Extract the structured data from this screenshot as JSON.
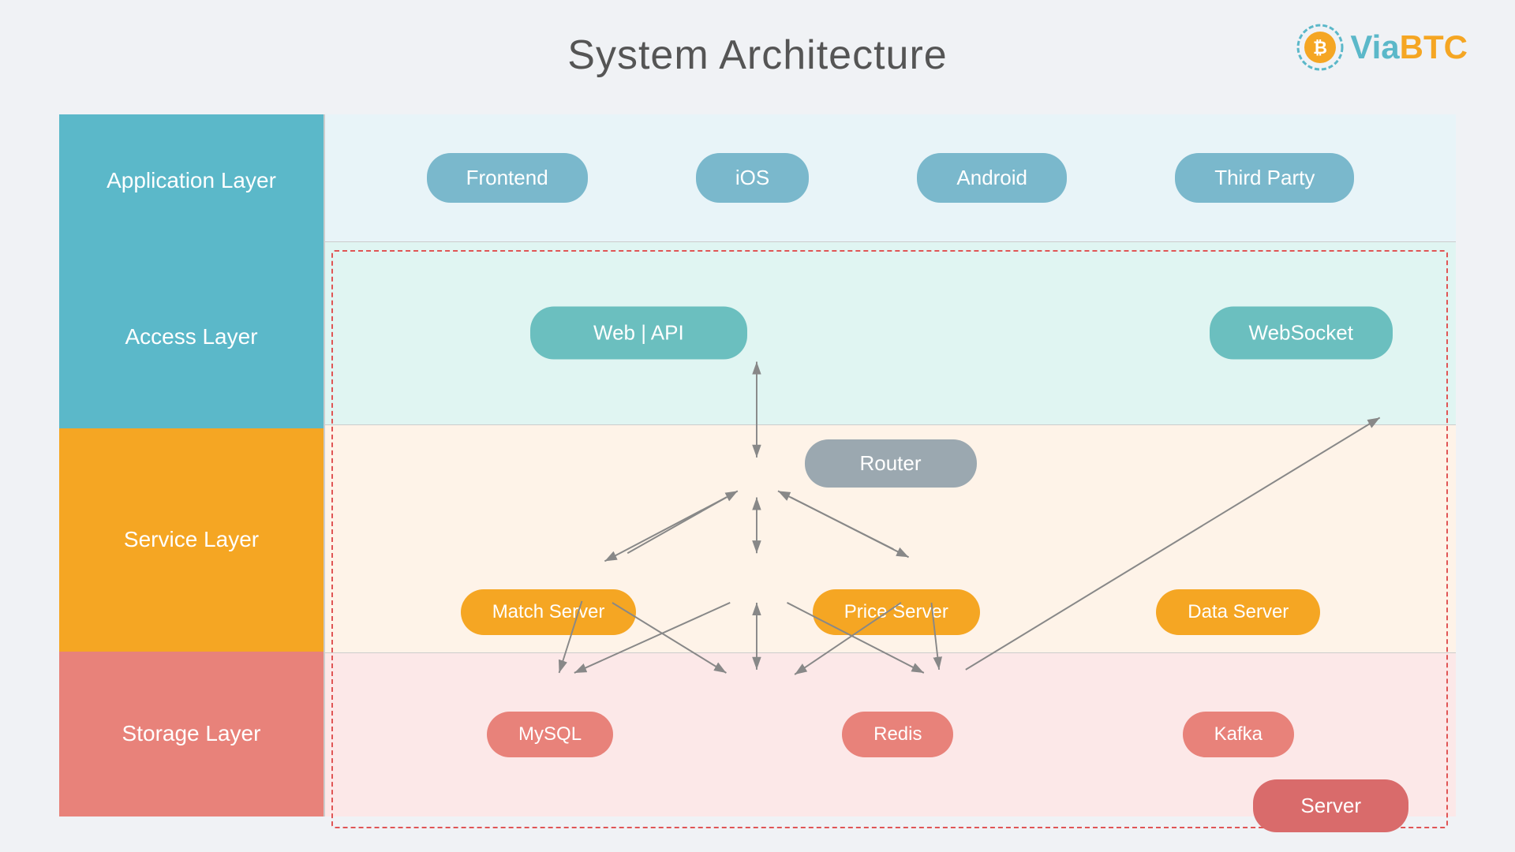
{
  "page": {
    "title": "System Architecture",
    "logo": {
      "via": "Via",
      "btc": "BTC"
    }
  },
  "layers": {
    "application": "Application Layer",
    "access": "Access Layer",
    "service": "Service Layer",
    "storage": "Storage Layer"
  },
  "app_pills": [
    "Frontend",
    "iOS",
    "Android",
    "Third Party"
  ],
  "access_pills": {
    "web_api": "Web  |  API",
    "websocket": "WebSocket"
  },
  "service_pills": {
    "router": "Router",
    "match": "Match Server",
    "price": "Price Server",
    "data": "Data Server"
  },
  "storage_pills": {
    "mysql": "MySQL",
    "redis": "Redis",
    "kafka": "Kafka"
  },
  "server": "Server"
}
